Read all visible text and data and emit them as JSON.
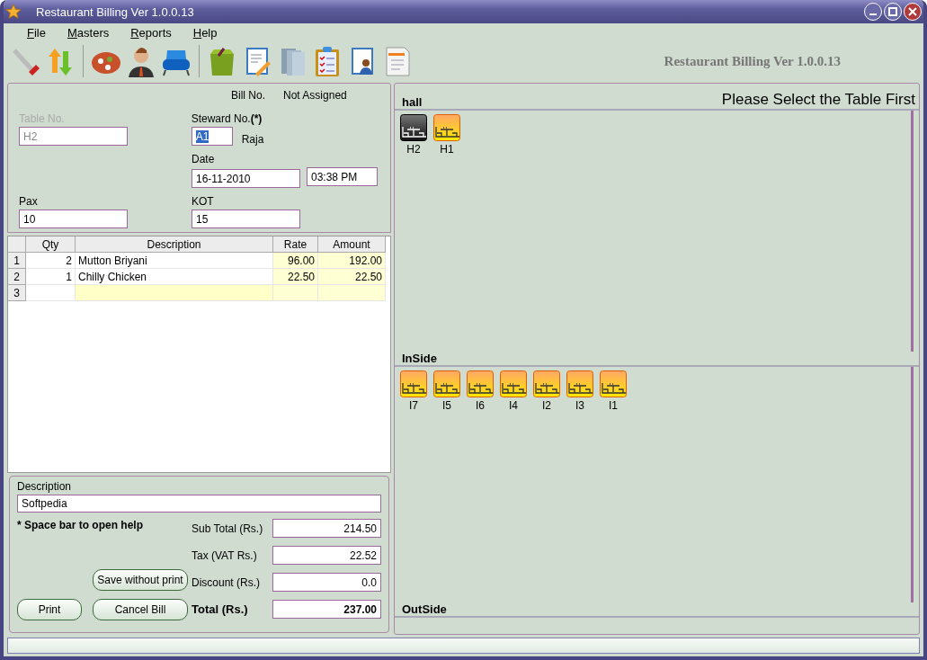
{
  "window": {
    "title": "Restaurant Billing Ver 1.0.0.13"
  },
  "menu": [
    "File",
    "Masters",
    "Reports",
    "Help"
  ],
  "toolbar": {
    "items": [
      {
        "kind": "tools"
      },
      {
        "kind": "arrows"
      },
      {
        "kind": "separator"
      },
      {
        "kind": "pizza"
      },
      {
        "kind": "person"
      },
      {
        "kind": "chair"
      },
      {
        "kind": "separator"
      },
      {
        "kind": "bag"
      },
      {
        "kind": "notebook"
      },
      {
        "kind": "binders"
      },
      {
        "kind": "clipboard"
      },
      {
        "kind": "contacts"
      },
      {
        "kind": "document"
      }
    ],
    "app_title": "Restaurant Billing Ver 1.0.0.13"
  },
  "bill": {
    "bill_no_label": "Bill No.",
    "bill_no": "Not Assigned",
    "table_no": {
      "label": "Table No.",
      "value": "H2",
      "disabled": true
    },
    "steward": {
      "label": "Steward No.",
      "required_mark": "(*)",
      "value": "A1",
      "name": "Raja"
    },
    "date": {
      "label": "Date",
      "value": "16-11-2010",
      "time": "03:38 PM"
    },
    "pax": {
      "label": "Pax",
      "value": "10"
    },
    "kot": {
      "label": "KOT",
      "value": "15"
    }
  },
  "items": {
    "columns": [
      "Qty",
      "Description",
      "Rate",
      "Amount"
    ],
    "rows": [
      {
        "index": "1",
        "qty": "2",
        "description": "Mutton Briyani",
        "rate": "96.00",
        "amount": "192.00",
        "current": false
      },
      {
        "index": "2",
        "qty": "1",
        "description": "Chilly Chicken",
        "rate": "22.50",
        "amount": "22.50",
        "current": false
      },
      {
        "index": "3",
        "current": true
      }
    ]
  },
  "footer": {
    "description": {
      "label": "Description",
      "value": "Softpedia"
    },
    "hint": "* Space bar to open help",
    "totals": [
      {
        "label": "Sub Total (Rs.)",
        "value": "214.50",
        "bold": false
      },
      {
        "label": "Tax (VAT Rs.)",
        "value": "22.52",
        "bold": false
      },
      {
        "label": "Discount (Rs.)",
        "value": "0.0",
        "bold": false
      },
      {
        "label": "Total (Rs.)",
        "value": "237.00",
        "bold": true
      }
    ],
    "buttons": {
      "save_without_print": "Save without print",
      "print": "Print",
      "cancel": "Cancel Bill"
    }
  },
  "tables_panel": {
    "prompt": "Please Select the Table First",
    "sections": [
      {
        "name": "hall",
        "tables": [
          {
            "label": "H2",
            "selected": true
          },
          {
            "label": "H1",
            "selected": false
          }
        ]
      },
      {
        "name": "InSide",
        "tables": [
          {
            "label": "I7",
            "selected": false
          },
          {
            "label": "I5",
            "selected": false
          },
          {
            "label": "I6",
            "selected": false
          },
          {
            "label": "I4",
            "selected": false
          },
          {
            "label": "I2",
            "selected": false
          },
          {
            "label": "I3",
            "selected": false
          },
          {
            "label": "I1",
            "selected": false
          }
        ]
      },
      {
        "name": "OutSide"
      }
    ]
  }
}
